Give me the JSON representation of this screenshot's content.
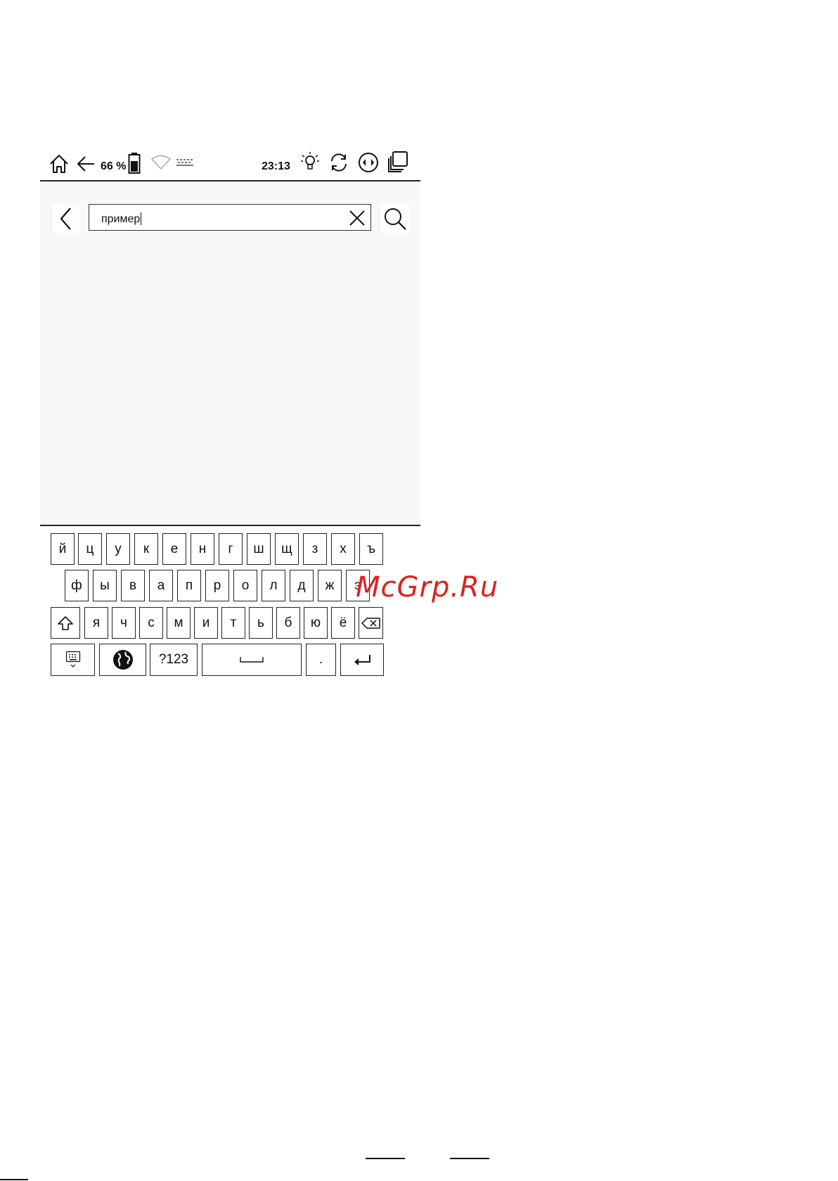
{
  "status_bar": {
    "battery_percent": "66 %",
    "time": "23:13"
  },
  "search": {
    "query": "пример"
  },
  "keyboard": {
    "row1": [
      "й",
      "ц",
      "у",
      "к",
      "е",
      "н",
      "г",
      "ш",
      "щ",
      "з",
      "х",
      "ъ"
    ],
    "row2": [
      "ф",
      "ы",
      "в",
      "а",
      "п",
      "р",
      "о",
      "л",
      "д",
      "ж",
      "э"
    ],
    "row3": [
      "я",
      "ч",
      "с",
      "м",
      "и",
      "т",
      "ь",
      "б",
      "ю",
      "ё"
    ],
    "numbers_label": "?123",
    "period_label": "."
  },
  "watermark": "McGrp.Ru",
  "colors": {
    "watermark": "#e0201c",
    "frame": "#222222",
    "content_bg": "#f8f8f8"
  }
}
